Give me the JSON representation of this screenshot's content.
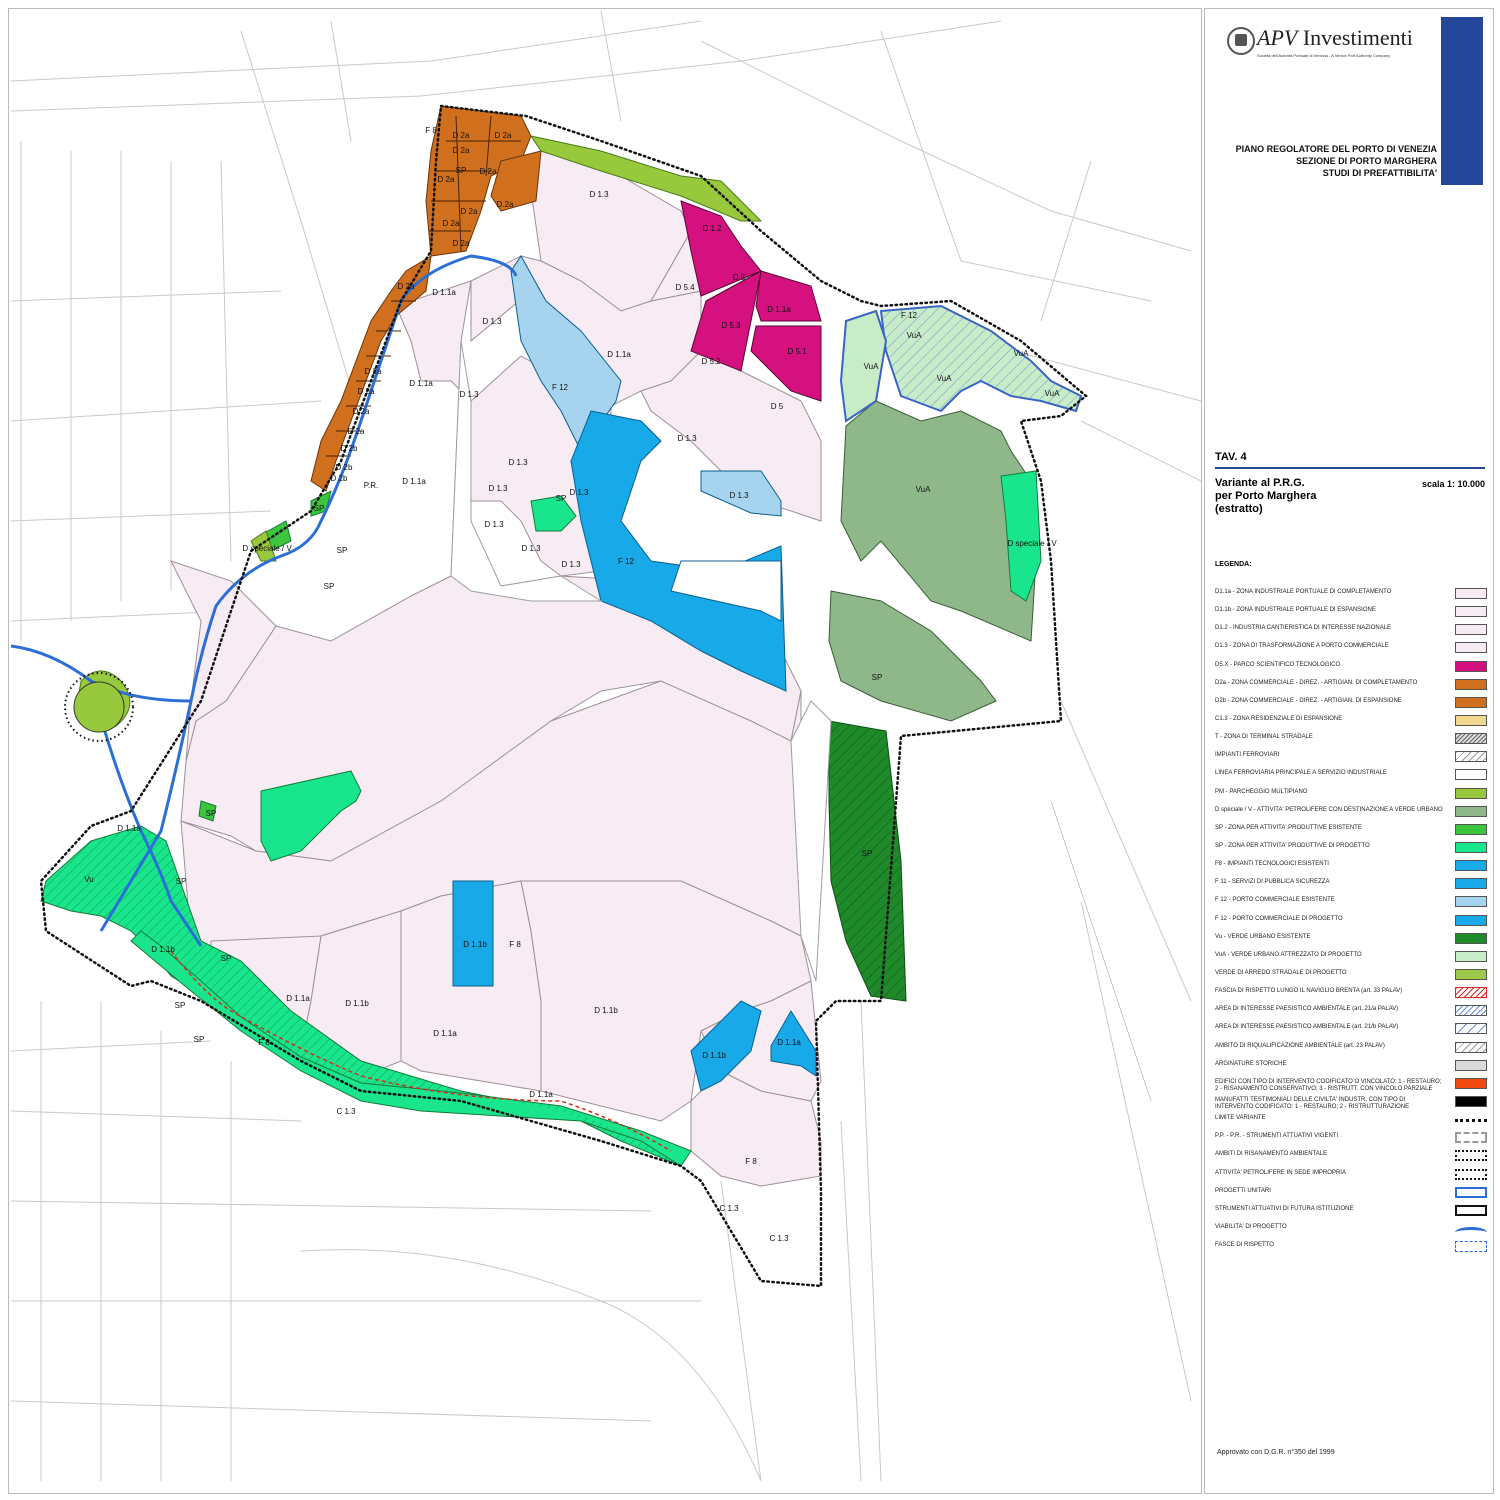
{
  "panel": {
    "logo_brand": "APV",
    "logo_name": "Investimenti",
    "logo_sub": "Società dell'Autorità Portuale di Venezia - A Venice Port Authority Company",
    "title_lines": [
      "PIANO REGOLATORE DEL PORTO DI VENEZIA",
      "SEZIONE DI PORTO MARGHERA",
      "STUDI DI PREFATTIBILITA'"
    ],
    "tav": "TAV. 4",
    "subtitle_lines": [
      "Variante al P.R.G.",
      "per Porto Marghera",
      "(estratto)"
    ],
    "scale": "scala 1: 10.000",
    "legend_heading": "LEGENDA:",
    "footer": "Approvato con D.G.R. n°350 del 1999"
  },
  "legend": [
    {
      "label": "D1.1a - ZONA INDUSTRIALE PORTUALE DI COMPLETAMENTO",
      "fill": "#f7ecf3",
      "pattern": "solid"
    },
    {
      "label": "D1.1b - ZONA INDUSTRIALE PORTUALE DI ESPANSIONE",
      "fill": "#f7ecf3",
      "pattern": "solid"
    },
    {
      "label": "D1.2 - INDUSTRIA CANTIERISTICA DI INTERESSE NAZIONALE",
      "fill": "#f7ecf3",
      "pattern": "solid"
    },
    {
      "label": "D1.3 - ZONA DI TRASFORMAZIONE A PORTO COMMERCIALE",
      "fill": "#f7ecf3",
      "pattern": "solid"
    },
    {
      "label": "D5.X - PARCO SCIENTIFICO TECNOLOGICO",
      "fill": "#d4117f",
      "pattern": "solid"
    },
    {
      "label": "D2a - ZONA COMMERCIALE - DIREZ. - ARTIGIAN. DI COMPLETAMENTO",
      "fill": "#d0701e",
      "pattern": "solid"
    },
    {
      "label": "D2b - ZONA COMMERCIALE - DIREZ. - ARTIGIAN. DI ESPANSIONE",
      "fill": "#d0701e",
      "pattern": "solid"
    },
    {
      "label": "C1.3 - ZONA RESIDENZIALE DI ESPANSIONE",
      "fill": "#f0d98c",
      "pattern": "solid"
    },
    {
      "label": "T - ZONA DI TERMINAL STRADALE",
      "fill": "#dddddd",
      "pattern": "hatch-dense"
    },
    {
      "label": "IMPIANTI FERROVIARI",
      "fill": "#ffffff",
      "pattern": "hatch"
    },
    {
      "label": "LINEA FERROVIARIA PRINCIPALE A SERVIZIO INDUSTRIALE",
      "fill": "#ffffff",
      "pattern": "solid"
    },
    {
      "label": "PM - PARCHEGGIO MULTIPIANO",
      "fill": "#98c83c",
      "pattern": "solid"
    },
    {
      "label": "D speciale / V - ATTIVITA' PETROLIFERE CON DESTINAZIONE A VERDE URBANO",
      "fill": "#8fb88a",
      "pattern": "solid"
    },
    {
      "label": "SP - ZONA PER ATTIVITA' PRODUTTIVE ESISTENTE",
      "fill": "#3dc63d",
      "pattern": "solid"
    },
    {
      "label": "SP - ZONA PER ATTIVITA' PRODUTTIVE DI PROGETTO",
      "fill": "#19e68c",
      "pattern": "solid"
    },
    {
      "label": "F8 - IMPIANTI TECNOLOGICI ESISTENTI",
      "fill": "#18a9e8",
      "pattern": "solid"
    },
    {
      "label": "F 11 - SERVIZI DI PUBBLICA SICUREZZA",
      "fill": "#18a9e8",
      "pattern": "solid"
    },
    {
      "label": "F 12 - PORTO COMMERCIALE ESISTENTE",
      "fill": "#a6d4ef",
      "pattern": "solid"
    },
    {
      "label": "F 12 - PORTO COMMERCIALE DI PROGETTO",
      "fill": "#18a9e8",
      "pattern": "solid"
    },
    {
      "label": "Vu - VERDE URBANO ESISTENTE",
      "fill": "#1f8a2a",
      "pattern": "solid"
    },
    {
      "label": "VuA - VERDE URBANO ATTREZZATO DI PROGETTO",
      "fill": "#c9ecc8",
      "pattern": "solid"
    },
    {
      "label": "VERDE DI ARREDO STRADALE DI PROGETTO",
      "fill": "#9dc84a",
      "pattern": "solid"
    },
    {
      "label": "FASCIA DI RISPETTO LUNGO IL NAVIGLIO BRENTA (art. 33 PALAV)",
      "fill": "#ffffff",
      "pattern": "red-hatch"
    },
    {
      "label": "AREA DI INTERESSE PAESISTICO AMBIENTALE (art. 21/a PALAV)",
      "fill": "#ffffff",
      "pattern": "blue-hatch"
    },
    {
      "label": "AREA DI INTERESSE PAESISTICO AMBIENTALE (art. 21/b PALAV)",
      "fill": "#ffffff",
      "pattern": "blue-hatch-light"
    },
    {
      "label": "AMBITO DI RIQUALIFICAZIONE AMBIENTALE (art. 23 PALAV)",
      "fill": "#ffffff",
      "pattern": "hatch-light"
    },
    {
      "label": "ARGINATURE STORICHE",
      "fill": "#d9d9d9",
      "pattern": "solid"
    },
    {
      "label": "EDIFICI CON TIPO DI INTERVENTO CODIFICATO O VINCOLATO: 1 - RESTAURO; 2 - RISANAMENTO CONSERVATIVO; 3 - RISTRUTT. CON VINCOLO PARZIALE",
      "fill": "#f04a10",
      "pattern": "solid"
    },
    {
      "label": "MANUFATTI TESTIMONIALI DELLE CIVILTA' INDUSTR. CON TIPO DI INTERVENTO CODIFICATO: 1 - RESTAURO; 2 - RISTRUTTURAZIONE",
      "fill": "#000000",
      "pattern": "solid"
    },
    {
      "label": "LIMITE VARIANTE",
      "fill": "#ffffff",
      "pattern": "dots"
    },
    {
      "label": "P.P. - P.R. - STRUMENTI ATTUATIVI VIGENTI",
      "fill": "#ffffff",
      "pattern": "grey-dash"
    },
    {
      "label": "AMBITI DI RISANAMENTO AMBIENTALE",
      "fill": "#ffffff",
      "pattern": "dot-border"
    },
    {
      "label": "ATTIVITA' PETROLIFERE IN SEDE IMPROPRIA",
      "fill": "#ffffff",
      "pattern": "dot-border"
    },
    {
      "label": "PROGETTI UNITARI",
      "fill": "#ffffff",
      "pattern": "blue-border"
    },
    {
      "label": "STRUMENTI ATTUATIVI DI FUTURA ISTITUZIONE",
      "fill": "#ffffff",
      "pattern": "black-border"
    },
    {
      "label": "VIABILITA' DI PROGETTO",
      "fill": "#ffffff",
      "pattern": "road"
    },
    {
      "label": "FASCE DI RISPETTO",
      "fill": "#ffffff",
      "pattern": "blue-dash"
    }
  ],
  "zone_labels": [
    "F 8",
    "D 2a",
    "D 2a",
    "D 2a",
    "SP",
    "D 2a",
    "D 2a",
    "D 2a",
    "D 2a",
    "D 2a",
    "D.2a",
    "D 2a",
    "D 1.1a",
    "D 1.3",
    "D 2a",
    "D 2a",
    "D 2a",
    "D 2a",
    "D 2b",
    "D 2b",
    "D 2b",
    "P.R.",
    "D 1.1a",
    "D 1.1a",
    "D 1.3",
    "D 1.3",
    "F 12",
    "D 1.3",
    "D 1.3",
    "D 1.3",
    "SP",
    "D 1.3",
    "D 1.3",
    "D 1.3",
    "D 1.2",
    "D 5",
    "D 5.4",
    "D 1.1a",
    "D 5.3",
    "D 5.1",
    "D 5.2",
    "D 5",
    "D 1.1a",
    "D 1.3",
    "D 1.3",
    "F 12",
    "F 12",
    "VuA",
    "VuA",
    "VuA",
    "VuA",
    "VuA",
    "VuA",
    "D speciale / V",
    "SP",
    "D speciale / V",
    "SP",
    "SP",
    "SP",
    "D 1.1a",
    "D 1.1a",
    "SP",
    "SP",
    "Vu",
    "SP",
    "D 1.1b",
    "SP",
    "D 1.1b",
    "D 1.1a",
    "D 1.1b",
    "F 8",
    "D 1.1b",
    "D 1.1b",
    "D 1.1a",
    "F 8",
    "F 8",
    "D 1.1a",
    "SP",
    "SP",
    "C 1.3",
    "C 1.3",
    "C 1.3",
    "T",
    "P.P."
  ]
}
